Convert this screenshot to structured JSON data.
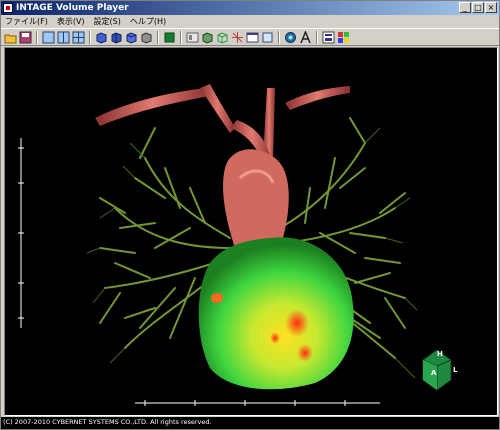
{
  "window": {
    "title": "INTAGE Volume Player",
    "buttons": [
      "_",
      "□",
      "×"
    ]
  },
  "menu": [
    {
      "label": "ファイル(F)"
    },
    {
      "label": "表示(V)"
    },
    {
      "label": "設定(S)"
    },
    {
      "label": "ヘルプ(H)"
    }
  ],
  "toolbar": {
    "tools": [
      {
        "name": "open-icon"
      },
      {
        "name": "save-icon"
      },
      {
        "name": "layout-single-icon"
      },
      {
        "name": "layout-two-icon"
      },
      {
        "name": "layout-four-icon"
      },
      {
        "name": "view-front-icon"
      },
      {
        "name": "view-side-icon"
      },
      {
        "name": "view-top-icon"
      },
      {
        "name": "view-gray-icon"
      },
      {
        "name": "render-mode-icon"
      },
      {
        "name": "volume-icon"
      },
      {
        "name": "cube-icon"
      },
      {
        "name": "wire-cube-icon"
      },
      {
        "name": "axis-icon"
      },
      {
        "name": "window-icon"
      },
      {
        "name": "frame-icon"
      },
      {
        "name": "camera-icon"
      },
      {
        "name": "text-a-icon"
      },
      {
        "name": "info-icon"
      },
      {
        "name": "palette-icon"
      }
    ]
  },
  "viewport": {
    "background": "#000000",
    "description_colors": {
      "vessel": "#c8605a",
      "lung": "#7fa83a",
      "heart": "#3fd640",
      "hot": "#ff3a1a"
    }
  },
  "orientation": {
    "front": "A",
    "top": "H",
    "right": "L"
  },
  "status": {
    "copyright": "(C) 2007-2010 CYBERNET SYSTEMS CO.,LTD. All rights reserved."
  }
}
